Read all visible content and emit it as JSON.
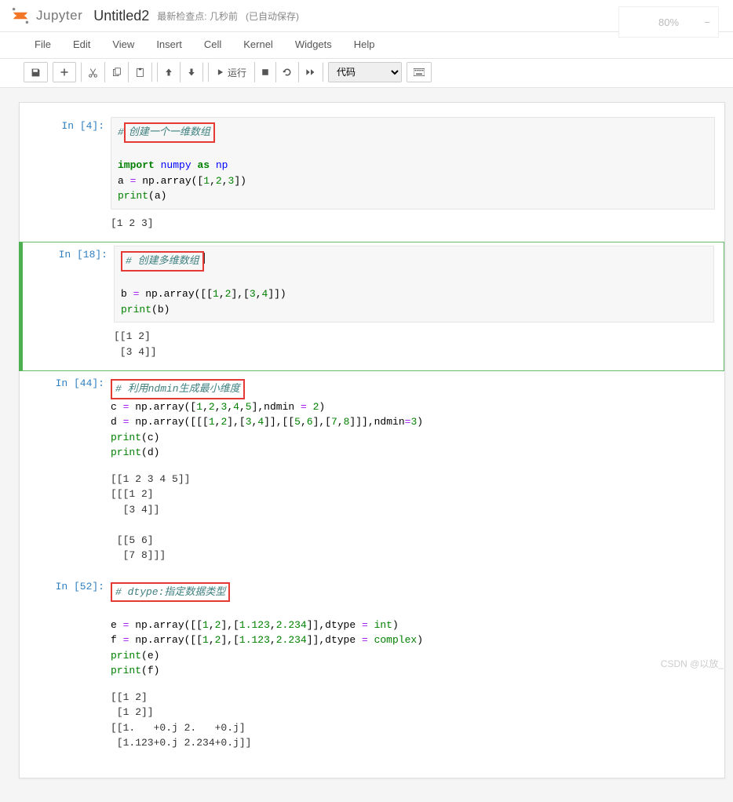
{
  "header": {
    "brand": "Jupyter",
    "title": "Untitled2",
    "checkpoint": "最新检查点: 几秒前",
    "autosave": "(已自动保存)"
  },
  "zoom": {
    "value": "80%",
    "minus": "−"
  },
  "menu": {
    "file": "File",
    "edit": "Edit",
    "view": "View",
    "insert": "Insert",
    "cell": "Cell",
    "kernel": "Kernel",
    "widgets": "Widgets",
    "help": "Help"
  },
  "toolbar": {
    "run": "运行",
    "celltype": "代码"
  },
  "cells": [
    {
      "prompt": "In  [4]:",
      "comment_highlight": "创建一个一维数组",
      "code_lines": [
        "",
        "import numpy as np",
        "a = np.array([1,2,3])",
        "print(a)"
      ],
      "output": "[1 2 3]"
    },
    {
      "prompt": "In [18]:",
      "comment_highlight": "# 创建多维数组",
      "code_lines": [
        "",
        "b = np.array([[1,2],[3,4]])",
        "print(b)"
      ],
      "output": "[[1 2]\n [3 4]]"
    },
    {
      "prompt": "In [44]:",
      "comment_highlight": "# 利用ndmin生成最小维度",
      "code_lines": [
        "c = np.array([1,2,3,4,5],ndmin = 2)",
        "d = np.array([[[1,2],[3,4]],[[5,6],[7,8]]],ndmin=3)",
        "print(c)",
        "print(d)"
      ],
      "output": "[[1 2 3 4 5]]\n[[[1 2]\n  [3 4]]\n\n [[5 6]\n  [7 8]]]"
    },
    {
      "prompt": "In [52]:",
      "comment_highlight": "# dtype:指定数据类型",
      "code_lines": [
        "",
        "e = np.array([[1,2],[1.123,2.234]],dtype = int)",
        "f = np.array([[1,2],[1.123,2.234]],dtype = complex)",
        "print(e)",
        "print(f)"
      ],
      "output": "[[1 2]\n [1 2]]\n[[1.   +0.j 2.   +0.j]\n [1.123+0.j 2.234+0.j]]"
    }
  ],
  "watermark": "CSDN @以放_"
}
